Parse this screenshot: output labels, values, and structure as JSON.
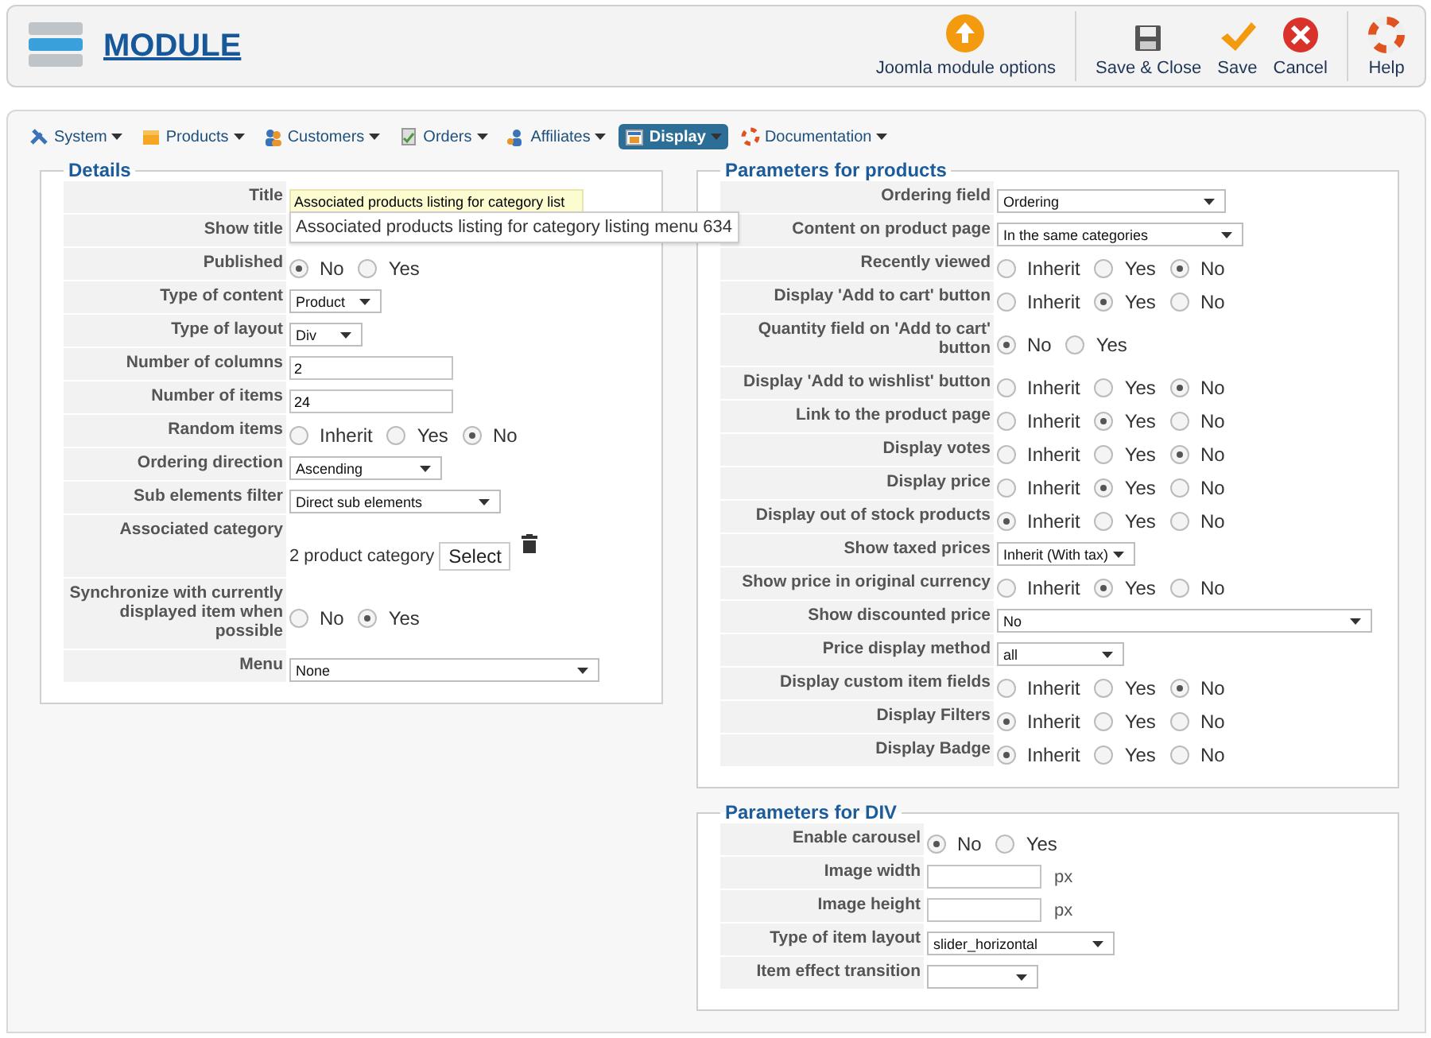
{
  "header": {
    "title": "MODULE",
    "toolbar_groups": [
      [
        {
          "label": "Joomla module options",
          "kind": "options"
        }
      ],
      [
        {
          "label": "Save & Close",
          "kind": "save-close"
        },
        {
          "label": "Save",
          "kind": "save"
        },
        {
          "label": "Cancel",
          "kind": "cancel"
        }
      ],
      [
        {
          "label": "Help",
          "kind": "help"
        }
      ]
    ]
  },
  "nav": [
    {
      "label": "System",
      "kind": "tools",
      "selected": false
    },
    {
      "label": "Products",
      "kind": "box",
      "selected": false
    },
    {
      "label": "Customers",
      "kind": "users",
      "selected": false
    },
    {
      "label": "Orders",
      "kind": "orders",
      "selected": false
    },
    {
      "label": "Affiliates",
      "kind": "affiliates",
      "selected": false
    },
    {
      "label": "Display",
      "kind": "display",
      "selected": true
    },
    {
      "label": "Documentation",
      "kind": "help",
      "selected": false
    }
  ],
  "sections": [
    {
      "title": "Details",
      "rows": [
        {
          "label": "Title",
          "kind": "title",
          "value": "Associated products listing for category list",
          "tooltip": "Associated products listing for category listing menu 634"
        },
        {
          "label": "Show title",
          "kind": "covered"
        },
        {
          "label": "Published",
          "kind": "radio",
          "options": [
            {
              "label": "No",
              "selected": true
            },
            {
              "label": "Yes",
              "selected": false
            }
          ]
        },
        {
          "label": "Type of content",
          "kind": "select",
          "value": "Product"
        },
        {
          "label": "Type of layout",
          "kind": "select",
          "value": "Div"
        },
        {
          "label": "Number of columns",
          "kind": "text",
          "value": "2"
        },
        {
          "label": "Number of items",
          "kind": "text",
          "value": "24"
        },
        {
          "label": "Random items",
          "kind": "radio",
          "options": [
            {
              "label": "Inherit",
              "selected": false
            },
            {
              "label": "Yes",
              "selected": false
            },
            {
              "label": "No",
              "selected": true
            }
          ]
        },
        {
          "label": "Ordering direction",
          "kind": "select",
          "value": "Ascending"
        },
        {
          "label": "Sub elements filter",
          "kind": "select",
          "value": "Direct sub elements"
        },
        {
          "label": "Associated category",
          "kind": "category",
          "value": "2 product category",
          "button": "Select"
        },
        {
          "label": "Synchronize with currently displayed item when possible",
          "kind": "radio",
          "options": [
            {
              "label": "No",
              "selected": false
            },
            {
              "label": "Yes",
              "selected": true
            }
          ]
        },
        {
          "label": "Menu",
          "kind": "select",
          "value": "None"
        }
      ]
    },
    {
      "title": "Parameters for products",
      "rows": [
        {
          "label": "Ordering field",
          "kind": "select",
          "value": "Ordering"
        },
        {
          "label": "Content on product page",
          "kind": "select",
          "value": "In the same categories"
        },
        {
          "label": "Recently viewed",
          "kind": "radio",
          "options": [
            {
              "label": "Inherit",
              "selected": false
            },
            {
              "label": "Yes",
              "selected": false
            },
            {
              "label": "No",
              "selected": true
            }
          ]
        },
        {
          "label": "Display 'Add to cart' button",
          "kind": "radio",
          "options": [
            {
              "label": "Inherit",
              "selected": false
            },
            {
              "label": "Yes",
              "selected": true
            },
            {
              "label": "No",
              "selected": false
            }
          ]
        },
        {
          "label": "Quantity field on 'Add to cart' button",
          "kind": "radio",
          "options": [
            {
              "label": "No",
              "selected": true
            },
            {
              "label": "Yes",
              "selected": false
            }
          ]
        },
        {
          "label": "Display 'Add to wishlist' button",
          "kind": "radio",
          "options": [
            {
              "label": "Inherit",
              "selected": false
            },
            {
              "label": "Yes",
              "selected": false
            },
            {
              "label": "No",
              "selected": true
            }
          ]
        },
        {
          "label": "Link to the product page",
          "kind": "radio",
          "options": [
            {
              "label": "Inherit",
              "selected": false
            },
            {
              "label": "Yes",
              "selected": true
            },
            {
              "label": "No",
              "selected": false
            }
          ]
        },
        {
          "label": "Display votes",
          "kind": "radio",
          "options": [
            {
              "label": "Inherit",
              "selected": false
            },
            {
              "label": "Yes",
              "selected": false
            },
            {
              "label": "No",
              "selected": true
            }
          ]
        },
        {
          "label": "Display price",
          "kind": "radio",
          "options": [
            {
              "label": "Inherit",
              "selected": false
            },
            {
              "label": "Yes",
              "selected": true
            },
            {
              "label": "No",
              "selected": false
            }
          ]
        },
        {
          "label": "Display out of stock products",
          "kind": "radio",
          "options": [
            {
              "label": "Inherit",
              "selected": true
            },
            {
              "label": "Yes",
              "selected": false
            },
            {
              "label": "No",
              "selected": false
            }
          ]
        },
        {
          "label": "Show taxed prices",
          "kind": "select",
          "value": "Inherit (With tax)"
        },
        {
          "label": "Show price in original currency",
          "kind": "radio",
          "options": [
            {
              "label": "Inherit",
              "selected": false
            },
            {
              "label": "Yes",
              "selected": true
            },
            {
              "label": "No",
              "selected": false
            }
          ]
        },
        {
          "label": "Show discounted price",
          "kind": "select",
          "value": "No"
        },
        {
          "label": "Price display method",
          "kind": "select",
          "value": "all"
        },
        {
          "label": "Display custom item fields",
          "kind": "radio",
          "options": [
            {
              "label": "Inherit",
              "selected": false
            },
            {
              "label": "Yes",
              "selected": false
            },
            {
              "label": "No",
              "selected": true
            }
          ]
        },
        {
          "label": "Display Filters",
          "kind": "radio",
          "options": [
            {
              "label": "Inherit",
              "selected": true
            },
            {
              "label": "Yes",
              "selected": false
            },
            {
              "label": "No",
              "selected": false
            }
          ]
        },
        {
          "label": "Display Badge",
          "kind": "radio",
          "options": [
            {
              "label": "Inherit",
              "selected": true
            },
            {
              "label": "Yes",
              "selected": false
            },
            {
              "label": "No",
              "selected": false
            }
          ]
        }
      ]
    },
    {
      "title": "Parameters for DIV",
      "rows": [
        {
          "label": "Enable carousel",
          "kind": "radio",
          "options": [
            {
              "label": "No",
              "selected": true
            },
            {
              "label": "Yes",
              "selected": false
            }
          ]
        },
        {
          "label": "Image width",
          "kind": "unit",
          "unit": "px"
        },
        {
          "label": "Image height",
          "kind": "unit",
          "unit": "px"
        },
        {
          "label": "Type of item layout",
          "kind": "select",
          "value": "slider_horizontal"
        },
        {
          "label": "Item effect transition",
          "kind": "select"
        }
      ]
    }
  ]
}
